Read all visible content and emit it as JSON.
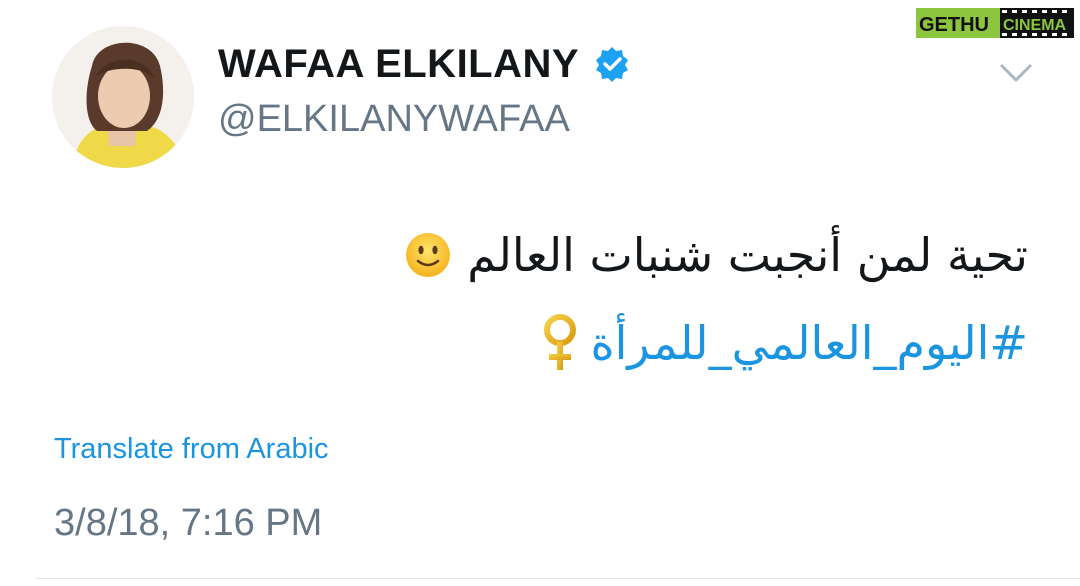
{
  "profile": {
    "display_name": "WAFAA ELKILANY",
    "handle": "@ELKILANYWAFAA",
    "verified": true
  },
  "icons": {
    "verified": "verified-badge-icon",
    "menu": "chevron-down-icon",
    "emoji": "slightly-smiling-face-icon",
    "symbol": "female-sign-icon"
  },
  "tweet": {
    "text": "تحية لمن أنجبت شنبات العالم",
    "hashtag": "#اليوم_العالمي_للمرأة",
    "translate_label": "Translate from Arabic",
    "timestamp": "3/8/18, 7:16 PM"
  },
  "watermark": {
    "part1": "GETHU",
    "part2": "CINEMA"
  },
  "colors": {
    "link": "#1b95e0",
    "text": "#14171a",
    "muted": "#657786",
    "verified": "#1da1f2",
    "watermark_green": "#8cc63f"
  }
}
